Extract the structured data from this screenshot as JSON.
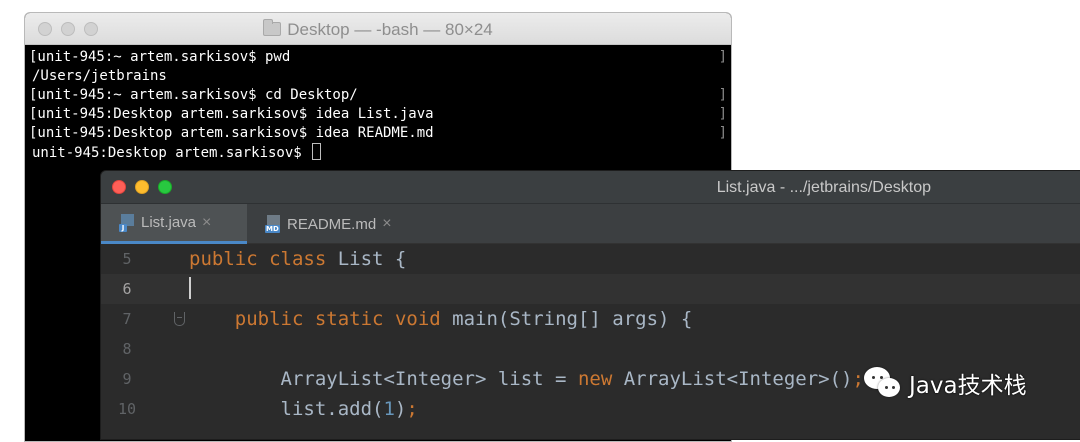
{
  "terminal": {
    "title": "Desktop — -bash — 80×24",
    "lines": [
      "[unit-945:~ artem.sarkisov$ pwd",
      "/Users/jetbrains",
      "[unit-945:~ artem.sarkisov$ cd Desktop/",
      "[unit-945:Desktop artem.sarkisov$ idea List.java",
      "[unit-945:Desktop artem.sarkisov$ idea README.md",
      "unit-945:Desktop artem.sarkisov$ "
    ]
  },
  "ide": {
    "title": "List.java - .../jetbrains/Desktop",
    "tabs": [
      {
        "label": "List.java",
        "icon": "java-file-icon",
        "active": true
      },
      {
        "label": "README.md",
        "icon": "markdown-file-icon",
        "active": false
      }
    ],
    "close_glyph": "×",
    "icon_badges": {
      "java": "J",
      "md": "MD"
    },
    "editor": {
      "lines": [
        {
          "number": "5",
          "tokens": [
            {
              "t": "public",
              "c": "kw"
            },
            {
              "t": " "
            },
            {
              "t": "class",
              "c": "kw"
            },
            {
              "t": " List {"
            }
          ]
        },
        {
          "number": "6",
          "tokens": [],
          "current": true,
          "caret": true
        },
        {
          "number": "7",
          "fold": true,
          "tokens": [
            {
              "t": "    "
            },
            {
              "t": "public",
              "c": "kw"
            },
            {
              "t": " "
            },
            {
              "t": "static",
              "c": "kw"
            },
            {
              "t": " "
            },
            {
              "t": "void",
              "c": "kw"
            },
            {
              "t": " main(String[] args) {"
            }
          ]
        },
        {
          "number": "8",
          "tokens": []
        },
        {
          "number": "9",
          "tokens": [
            {
              "t": "        ArrayList<Integer> list = "
            },
            {
              "t": "new",
              "c": "kw"
            },
            {
              "t": " ArrayList<Integer>()"
            },
            {
              "t": ";",
              "c": "kw"
            }
          ]
        },
        {
          "number": "10",
          "tokens": [
            {
              "t": "        list.add("
            },
            {
              "t": "1",
              "c": "num"
            },
            {
              "t": ")"
            },
            {
              "t": ";",
              "c": "kw"
            }
          ]
        }
      ]
    }
  },
  "watermark": {
    "text": "Java技术栈",
    "icon": "wechat-icon"
  }
}
